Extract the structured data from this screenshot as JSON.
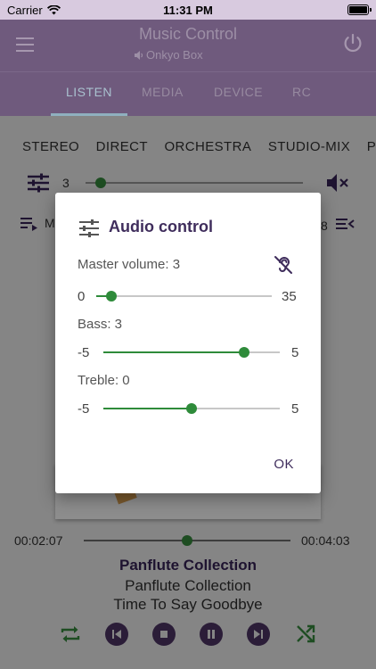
{
  "status_bar": {
    "carrier": "Carrier",
    "time": "11:31 PM"
  },
  "app_bar": {
    "title": "Music Control",
    "device": "Onkyo Box"
  },
  "tabs": [
    "LISTEN",
    "MEDIA",
    "DEVICE",
    "RC"
  ],
  "listening_modes": [
    "STEREO",
    "DIRECT",
    "ORCHESTRA",
    "STUDIO-MIX",
    "P"
  ],
  "background_volume": {
    "value": "3"
  },
  "background_row2": {
    "left": "M",
    "right": "8"
  },
  "player": {
    "elapsed": "00:02:07",
    "total": "00:04:03",
    "album_title": "Panflute Collection",
    "album_subtitle": "Panflute Collection",
    "track": "Time To Say Goodbye",
    "progress": 0.5
  },
  "dialog": {
    "title": "Audio control",
    "master_label": "Master volume: 3",
    "master_min": "0",
    "master_max": "35",
    "master_value": 3,
    "bass_label": "Bass: 3",
    "bass_min": "-5",
    "bass_max": "5",
    "bass_value": 3,
    "treble_label": "Treble: 0",
    "treble_min": "-5",
    "treble_max": "5",
    "treble_value": 0,
    "ok_label": "OK"
  },
  "colors": {
    "accent": "#2e8b3a",
    "primary": "#6f5a7d",
    "dialog_title": "#3f2d5c"
  },
  "icons": [
    "wifi-icon",
    "battery-icon",
    "menu-icon",
    "speaker-icon",
    "power-icon",
    "equalizer-icon",
    "mute-icon",
    "playlist-icon",
    "hearing-disabled-icon",
    "repeat-icon",
    "previous-icon",
    "stop-icon",
    "pause-icon",
    "next-icon",
    "shuffle-icon"
  ]
}
